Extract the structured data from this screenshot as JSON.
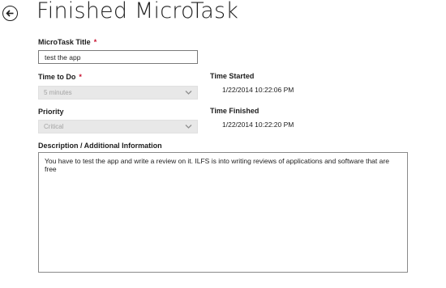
{
  "header": {
    "back_icon": "back-arrow-icon",
    "title": "Finished MicroTask"
  },
  "form": {
    "title_label": "MicroTask Title",
    "title_value": "test the app",
    "time_to_do_label": "Time to Do",
    "time_to_do_value": "5 minutes",
    "priority_label": "Priority",
    "priority_value": "Critical",
    "required_marker": "*",
    "time_started_label": "Time Started",
    "time_started_value": "1/22/2014 10:22:06 PM",
    "time_finished_label": "Time Finished",
    "time_finished_value": "1/22/2014 10:22:20 PM",
    "description_label": "Description / Additional Information",
    "description_value": "You have to test the app and write a review on it. ILFS is into writing reviews of applications and software that are free"
  },
  "colors": {
    "required": "#c8102e",
    "disabled_field_bg": "#e8e8e8",
    "disabled_field_text": "#a3a3a3"
  }
}
